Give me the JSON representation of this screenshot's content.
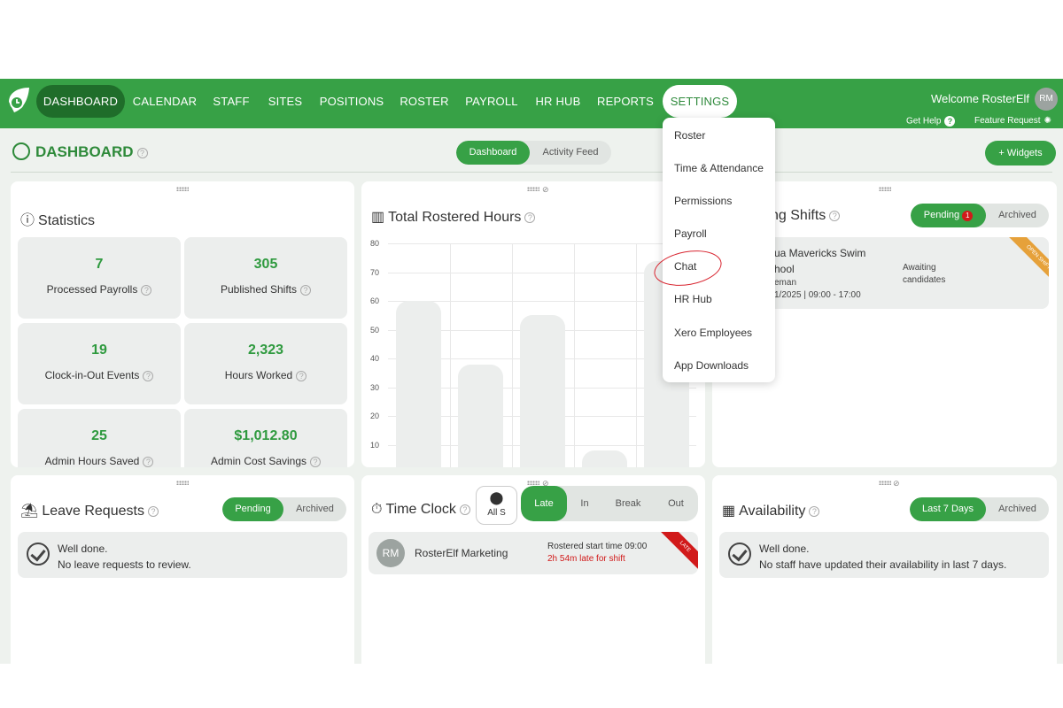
{
  "nav": {
    "items": [
      "DASHBOARD",
      "CALENDAR",
      "STAFF",
      "SITES",
      "POSITIONS",
      "ROSTER",
      "PAYROLL",
      "HR HUB",
      "REPORTS",
      "SETTINGS"
    ],
    "welcome": "Welcome RosterElf",
    "avatar": "RM",
    "get_help": "Get Help",
    "feature_request": "Feature Request"
  },
  "header": {
    "title": "DASHBOARD",
    "view_tabs": [
      "Dashboard",
      "Activity Feed"
    ],
    "widgets_button": "+ Widgets"
  },
  "settings_menu": [
    "Roster",
    "Time & Attendance",
    "Permissions",
    "Payroll",
    "Chat",
    "HR Hub",
    "Xero Employees",
    "App Downloads"
  ],
  "statistics": {
    "title": "Statistics",
    "items": [
      {
        "value": "7",
        "label": "Processed Payrolls"
      },
      {
        "value": "305",
        "label": "Published Shifts"
      },
      {
        "value": "19",
        "label": "Clock-in-Out Events"
      },
      {
        "value": "2,323",
        "label": "Hours Worked"
      },
      {
        "value": "25",
        "label": "Admin Hours Saved"
      },
      {
        "value": "$1,012.80",
        "label": "Admin Cost Savings"
      }
    ]
  },
  "rostered": {
    "title": "Total Rostered Hours",
    "yticks": [
      "80",
      "70",
      "60",
      "50",
      "40",
      "30",
      "20",
      "10"
    ]
  },
  "chart_data": {
    "type": "bar",
    "title": "Total Rostered Hours",
    "values": [
      60,
      38,
      55,
      8,
      74
    ],
    "ylim": [
      0,
      80
    ],
    "grid": true
  },
  "open_shifts": {
    "title": "ng Shifts",
    "tabs": [
      "Pending",
      "Archived"
    ],
    "pending_badge": "1",
    "shift_line1": "ua Mavericks Swim",
    "shift_line2": "hool",
    "shift_line3": "eman",
    "shift_line4": "1/2025 | 09:00 - 17:00",
    "status": "Awaiting candidates",
    "ribbon": "OPEN SHIFT"
  },
  "leave": {
    "title": "Leave Requests",
    "tabs": [
      "Pending",
      "Archived"
    ],
    "msg1": "Well done.",
    "msg2": "No leave requests to review."
  },
  "timeclock": {
    "title": "Time Clock",
    "filter_label": "All S",
    "tabs": [
      "Late",
      "In",
      "Break",
      "Out"
    ],
    "avatar": "RM",
    "name": "RosterElf Marketing",
    "start": "Rostered start time 09:00",
    "late": "2h 54m late for shift",
    "ribbon": "LATE"
  },
  "availability": {
    "title": "Availability",
    "tabs": [
      "Last 7 Days",
      "Archived"
    ],
    "msg1": "Well done.",
    "msg2": "No staff have updated their availability in last 7 days."
  },
  "colors": {
    "brand": "#37a146",
    "late": "#d11a1a"
  }
}
